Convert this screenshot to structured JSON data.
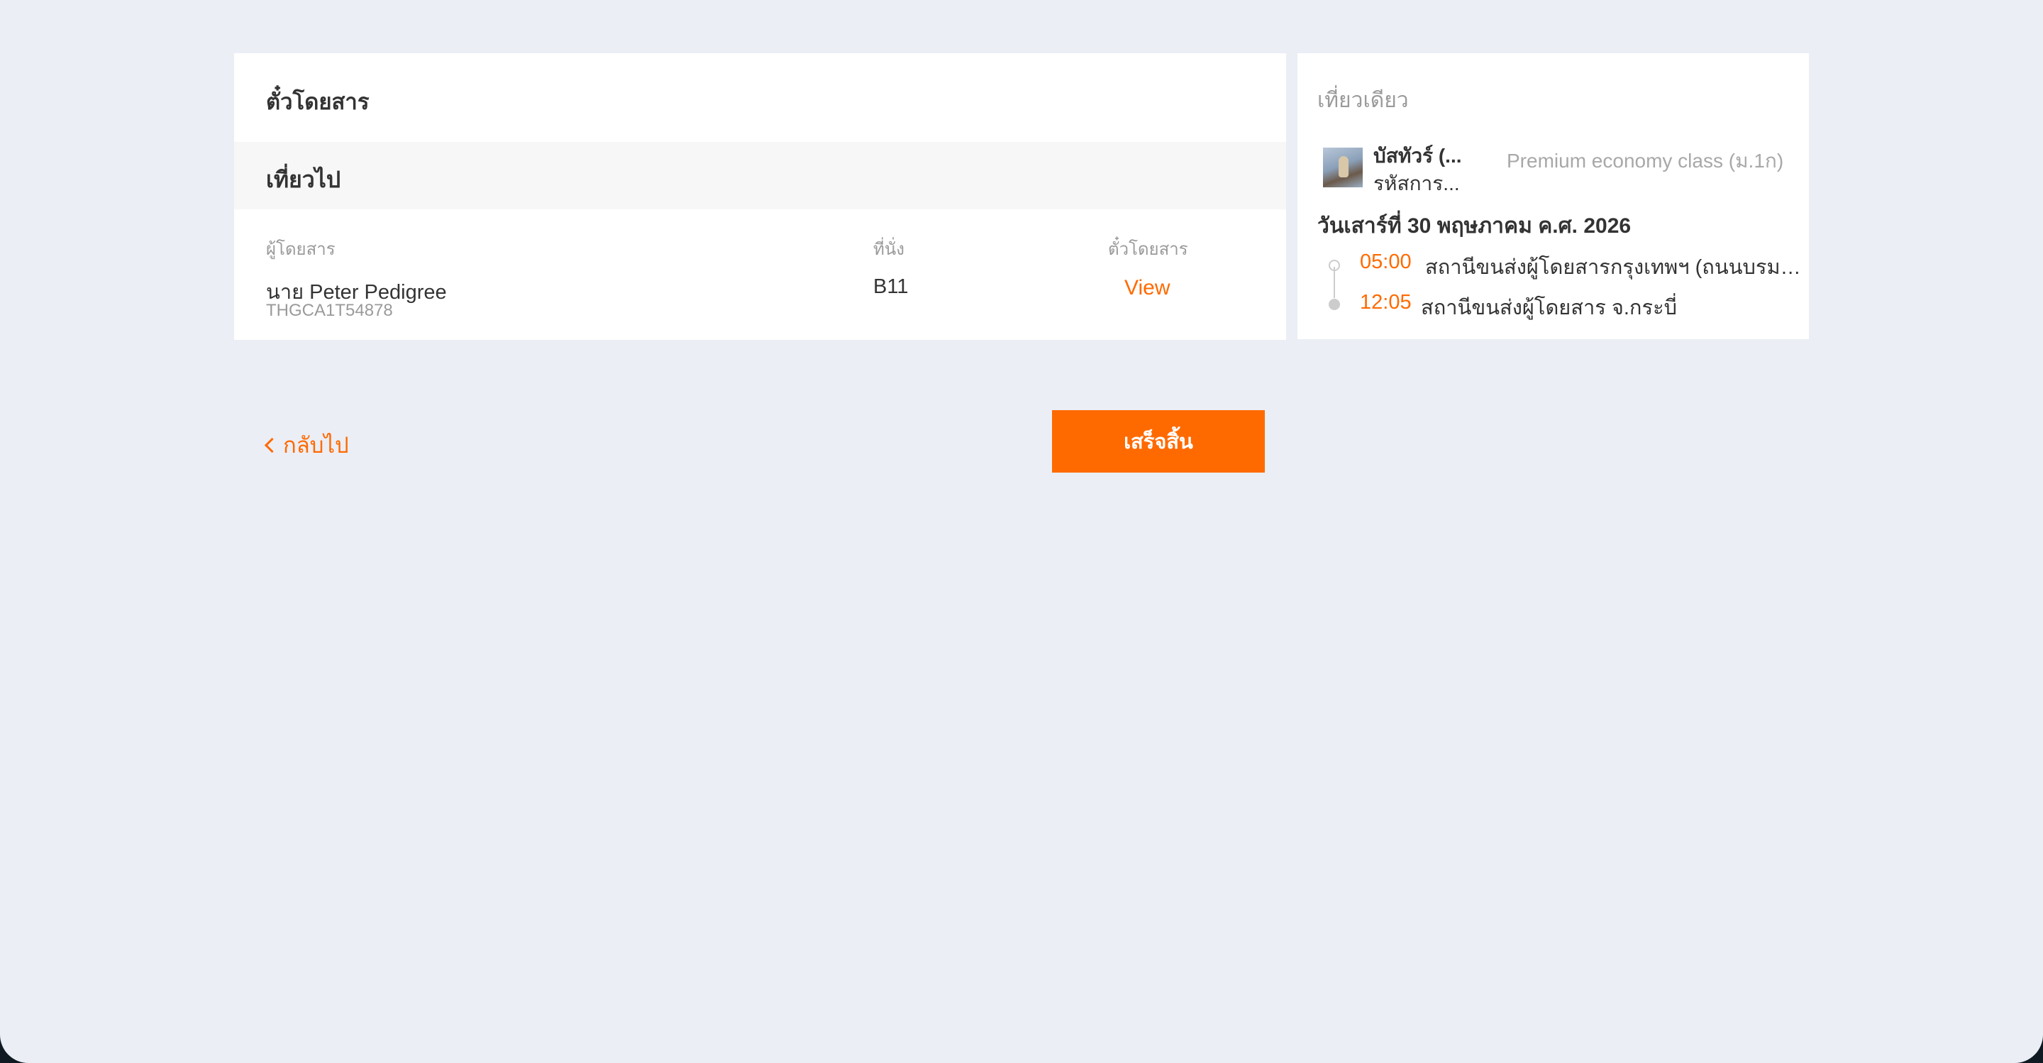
{
  "ticket": {
    "title": "ตั๋วโดยสาร",
    "outbound_label": "เที่ยวไป",
    "columns": {
      "passenger": "ผู้โดยสาร",
      "seat": "ที่นั่ง",
      "ticket": "ตั๋วโดยสาร"
    },
    "row": {
      "passenger_name": "นาย Peter Pedigree",
      "booking_code": "THGCA1T54878",
      "seat": "B11",
      "view_label": "View"
    }
  },
  "trip": {
    "title": "เที่ยวเดียว",
    "operator_name": "บัสทัวร์ (...",
    "operator_code": "รหัสการ...",
    "seat_class": "Premium economy class (ม.1ก)",
    "date": "วันเสาร์ที่ 30 พฤษภาคม ค.ศ. 2026",
    "departure": {
      "time": "05:00",
      "station": "สถานีขนส่งผู้โดยสารกรุงเทพฯ (ถนนบรมราชชนนี)"
    },
    "arrival": {
      "time": "12:05",
      "station": "สถานีขนส่งผู้โดยสาร จ.กระบี่"
    }
  },
  "actions": {
    "back_label": "กลับไป",
    "finish_label": "เสร็จสิ้น"
  },
  "colors": {
    "accent": "#ff6a00",
    "background": "#ebeef5",
    "card": "#ffffff"
  }
}
